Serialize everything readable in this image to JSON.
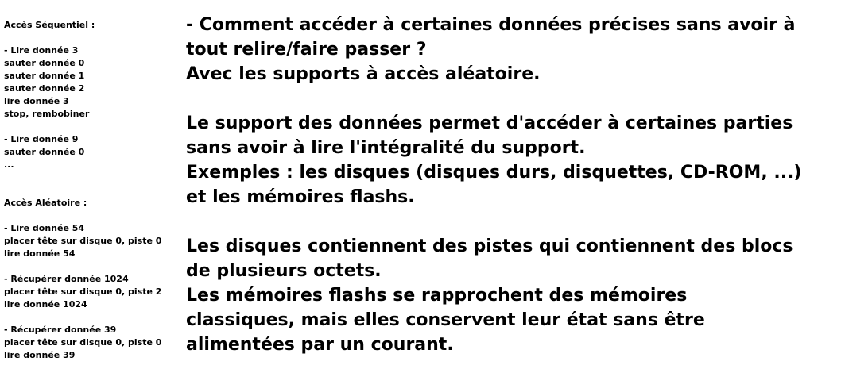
{
  "sequential": {
    "title": "Accès Séquentiel :",
    "blocks": [
      {
        "lines": [
          "- Lire donnée 3",
          "sauter donnée 0",
          "sauter donnée 1",
          "sauter donnée 2",
          "lire donnée 3",
          "stop, rembobiner"
        ]
      },
      {
        "lines": [
          "- Lire donnée 9",
          "sauter donnée 0",
          "..."
        ]
      }
    ]
  },
  "random": {
    "title": "Accès Aléatoire :",
    "blocks": [
      {
        "lines": [
          "- Lire donnée 54",
          "placer tête sur disque 0, piste 0",
          "lire donnée 54"
        ]
      },
      {
        "lines": [
          "- Récupérer donnée 1024",
          "placer tête sur disque 0, piste 2",
          "lire donnée 1024"
        ]
      },
      {
        "lines": [
          "- Récupérer donnée 39",
          "placer tête sur disque 0, piste 0",
          "lire donnée 39"
        ]
      }
    ]
  },
  "main_text": {
    "paragraphs": [
      {
        "lines": [
          "- Comment accéder à certaines données précises sans avoir à",
          "tout relire/faire passer ?",
          "Avec les supports à accès aléatoire."
        ]
      },
      {
        "lines": [
          "Le support des données permet d'accéder à certaines parties",
          "sans avoir à lire l'intégralité du support.",
          "Exemples : les disques (disques durs, disquettes, CD-ROM, ...)",
          "et les mémoires flashs."
        ]
      },
      {
        "lines": [
          "Les disques contiennent des pistes qui contiennent des blocs",
          "de plusieurs octets.",
          "Les mémoires flashs se rapprochent des mémoires",
          "classiques, mais elles conservent leur état sans être",
          "alimentées par un courant."
        ]
      }
    ]
  }
}
